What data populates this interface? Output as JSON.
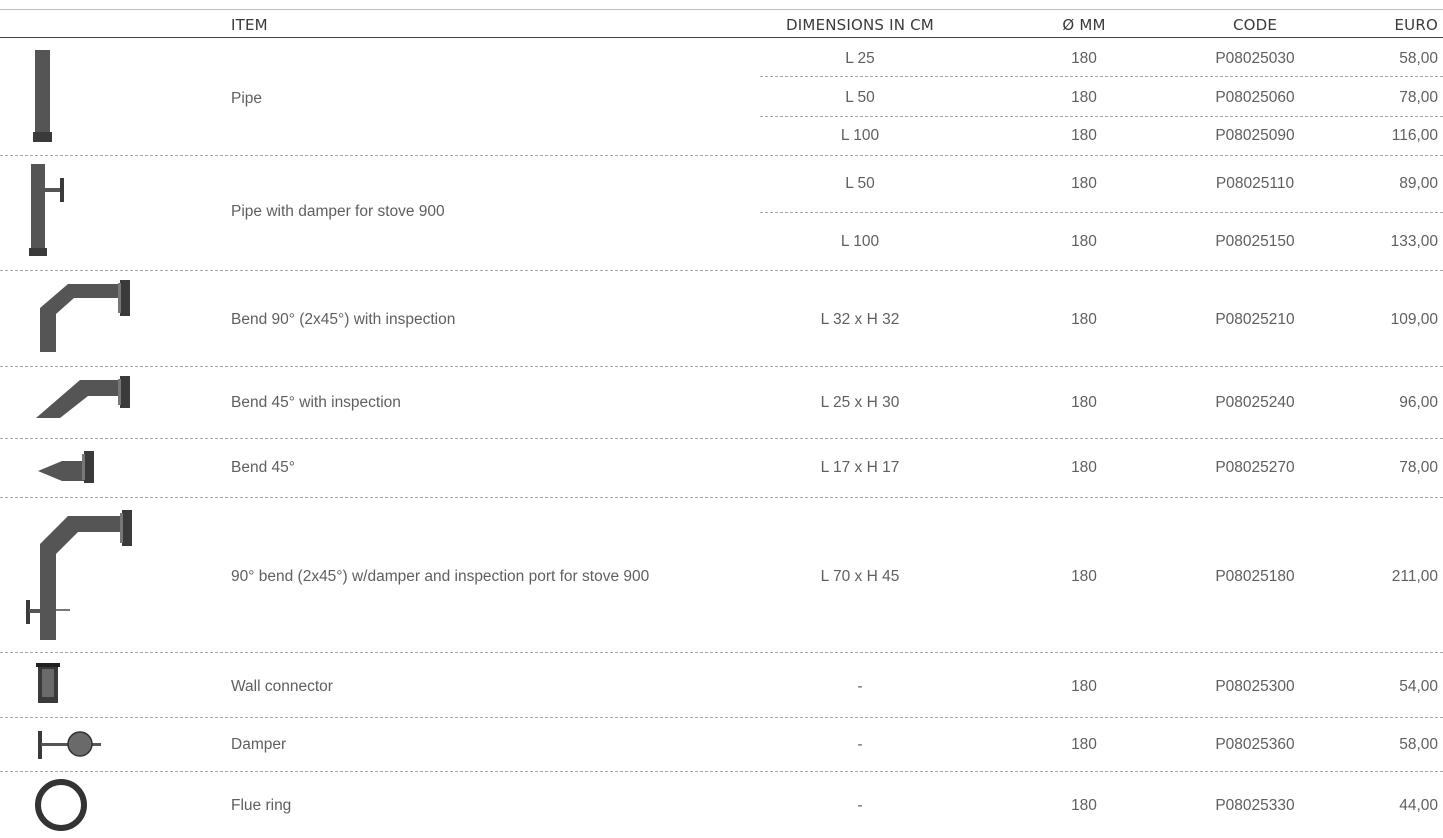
{
  "header": {
    "item": "ITEM",
    "dimensions": "DIMENSIONS IN CM",
    "diameter": "Ø MM",
    "code": "CODE",
    "euro": "EURO"
  },
  "rows": [
    {
      "item": "Pipe",
      "icon": "pipe-icon",
      "variants": [
        {
          "dim": "L 25",
          "dia": "180",
          "code": "P08025030",
          "euro": "58,00"
        },
        {
          "dim": "L 50",
          "dia": "180",
          "code": "P08025060",
          "euro": "78,00"
        },
        {
          "dim": "L 100",
          "dia": "180",
          "code": "P08025090",
          "euro": "116,00"
        }
      ]
    },
    {
      "item": "Pipe with damper for stove 900",
      "icon": "pipe-with-damper-icon",
      "variants": [
        {
          "dim": "L 50",
          "dia": "180",
          "code": "P08025110",
          "euro": "89,00"
        },
        {
          "dim": "L 100",
          "dia": "180",
          "code": "P08025150",
          "euro": "133,00"
        }
      ]
    },
    {
      "item": "Bend 90° (2x45°) with inspection",
      "icon": "bend-90-icon",
      "variants": [
        {
          "dim": "L 32 x H 32",
          "dia": "180",
          "code": "P08025210",
          "euro": "109,00"
        }
      ]
    },
    {
      "item": "Bend 45° with inspection",
      "icon": "bend-45-inspection-icon",
      "variants": [
        {
          "dim": "L 25 x H 30",
          "dia": "180",
          "code": "P08025240",
          "euro": "96,00"
        }
      ]
    },
    {
      "item": "Bend 45°",
      "icon": "bend-45-icon",
      "variants": [
        {
          "dim": "L 17 x H 17",
          "dia": "180",
          "code": "P08025270",
          "euro": "78,00"
        }
      ]
    },
    {
      "item": "90° bend (2x45°) w/damper and inspection port for stove 900",
      "icon": "bend-90-damper-icon",
      "variants": [
        {
          "dim": "L 70 x H 45",
          "dia": "180",
          "code": "P08025180",
          "euro": "211,00"
        }
      ]
    },
    {
      "item": "Wall connector",
      "icon": "wall-connector-icon",
      "variants": [
        {
          "dim": "-",
          "dia": "180",
          "code": "P08025300",
          "euro": "54,00"
        }
      ]
    },
    {
      "item": "Damper",
      "icon": "damper-icon",
      "variants": [
        {
          "dim": "-",
          "dia": "180",
          "code": "P08025360",
          "euro": "58,00"
        }
      ]
    },
    {
      "item": "Flue ring",
      "icon": "flue-ring-icon",
      "variants": [
        {
          "dim": "-",
          "dia": "180",
          "code": "P08025330",
          "euro": "44,00"
        }
      ]
    }
  ]
}
